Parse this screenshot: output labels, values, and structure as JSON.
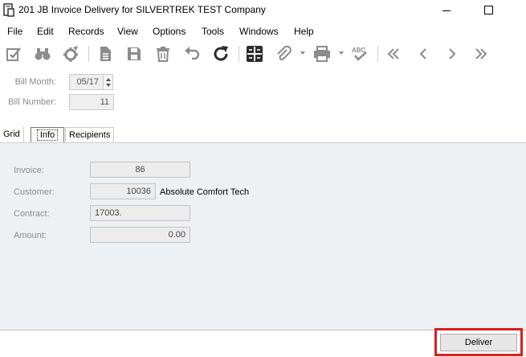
{
  "window": {
    "title": "201 JB Invoice Delivery for SILVERTREK TEST Company"
  },
  "menu": {
    "items": [
      "File",
      "Edit",
      "Records",
      "View",
      "Options",
      "Tools",
      "Windows",
      "Help"
    ]
  },
  "toolbar": {
    "icons": [
      "checklist-icon",
      "binoculars-icon",
      "settings-gear-icon",
      "document-icon",
      "save-icon",
      "delete-icon",
      "undo-icon",
      "refresh-icon",
      "calculator-icon",
      "attachment-icon",
      "print-icon",
      "spellcheck-icon",
      "first-record-icon",
      "previous-record-icon",
      "next-record-icon",
      "last-record-icon"
    ],
    "spellcheck_text": "ABC"
  },
  "header": {
    "bill_month_label": "Bill Month:",
    "bill_month_value": "05/17",
    "bill_number_label": "Bill Number:",
    "bill_number_value": "11"
  },
  "tabs": [
    {
      "label": "Grid"
    },
    {
      "label": "Info",
      "active": true
    },
    {
      "label": "Recipients"
    }
  ],
  "info": {
    "invoice_label": "Invoice:",
    "invoice_value": "86",
    "customer_label": "Customer:",
    "customer_value": "10036",
    "customer_name": "Absolute Comfort Tech",
    "contract_label": "Contract:",
    "contract_value": "17003.",
    "amount_label": "Amount:",
    "amount_value": "0.00"
  },
  "footer": {
    "deliver_label": "Deliver"
  },
  "colors": {
    "highlight": "#d9201f",
    "panel_bg": "#eef1f4",
    "icon_gray": "#8c8c8c",
    "icon_dark": "#2b2b2b"
  }
}
